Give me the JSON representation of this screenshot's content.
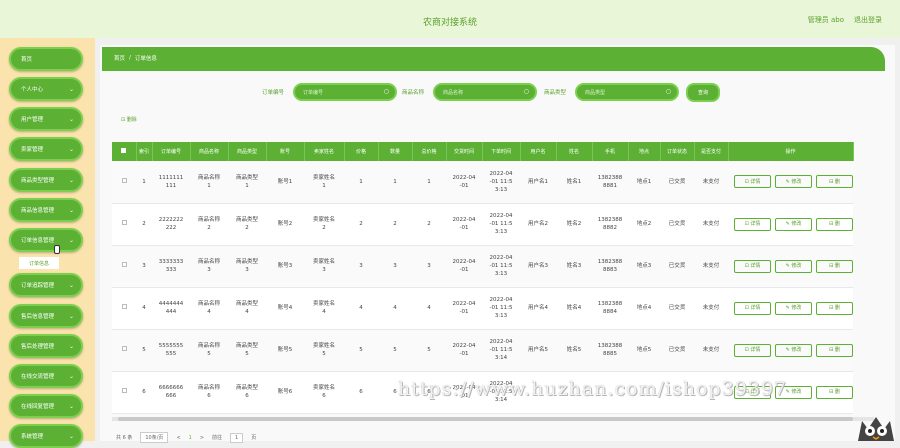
{
  "header": {
    "title": "农商对接系统",
    "user": "管理员 abo",
    "logout": "退出登录"
  },
  "sidebar": {
    "items": [
      {
        "label": "首页",
        "chev": ""
      },
      {
        "label": "个人中心",
        "chev": "⌄"
      },
      {
        "label": "用户管理",
        "chev": "⌄"
      },
      {
        "label": "卖家管理",
        "chev": "⌄"
      },
      {
        "label": "商品类型管理",
        "chev": "⌄"
      },
      {
        "label": "商品信息管理",
        "chev": "⌄"
      },
      {
        "label": "订单信息管理",
        "chev": "⌄"
      },
      {
        "label": "订单追踪管理",
        "chev": "⌄"
      },
      {
        "label": "售后信息管理",
        "chev": "⌄"
      },
      {
        "label": "售后处理管理",
        "chev": "⌄"
      },
      {
        "label": "在线交流管理",
        "chev": "⌄"
      },
      {
        "label": "在线回复管理",
        "chev": "⌄"
      },
      {
        "label": "系统管理",
        "chev": "⌄"
      }
    ],
    "sub_item": "订单信息"
  },
  "breadcrumb": {
    "home": "首页",
    "sep": "/",
    "current": "订单信息"
  },
  "search": {
    "order_no_label": "订单编号",
    "order_no_placeholder": "订单编号",
    "product_name_label": "商品名称",
    "product_name_placeholder": "商品名称",
    "product_type_label": "商品类型",
    "product_type_placeholder": "商品类型",
    "query_button": "查询"
  },
  "delete_button": "⊡ 删除",
  "table": {
    "headers": [
      "索引",
      "订单编号",
      "商品名称",
      "商品类型",
      "账号",
      "卖家姓名",
      "价格",
      "数量",
      "总价格",
      "交货时间",
      "下单时间",
      "用户名",
      "姓名",
      "手机",
      "地点",
      "订单状态",
      "是否支付",
      "操作"
    ],
    "rows": [
      {
        "idx": "1",
        "order": "1111111\n111",
        "name": "商品名称\n1",
        "type": "商品类型\n1",
        "acct": "账号1",
        "seller": "卖家姓名\n1",
        "price": "1",
        "qty": "1",
        "total": "1",
        "delivery": "2022-04\n-01",
        "time": "2022-04\n-01 11:5\n3:13",
        "user": "用户名1",
        "real": "姓名1",
        "phone": "1382388\n8881",
        "place": "地点1",
        "status": "已交货",
        "paid": "未支付"
      },
      {
        "idx": "2",
        "order": "2222222\n222",
        "name": "商品名称\n2",
        "type": "商品类型\n2",
        "acct": "账号2",
        "seller": "卖家姓名\n2",
        "price": "2",
        "qty": "2",
        "total": "2",
        "delivery": "2022-04\n-01",
        "time": "2022-04\n-01 11:5\n3:13",
        "user": "用户名2",
        "real": "姓名2",
        "phone": "1382388\n8882",
        "place": "地点2",
        "status": "已交货",
        "paid": "未支付"
      },
      {
        "idx": "3",
        "order": "3333333\n333",
        "name": "商品名称\n3",
        "type": "商品类型\n3",
        "acct": "账号3",
        "seller": "卖家姓名\n3",
        "price": "3",
        "qty": "3",
        "total": "3",
        "delivery": "2022-04\n-01",
        "time": "2022-04\n-01 11:5\n3:13",
        "user": "用户名3",
        "real": "姓名3",
        "phone": "1382388\n8883",
        "place": "地点3",
        "status": "已交货",
        "paid": "未支付"
      },
      {
        "idx": "4",
        "order": "4444444\n444",
        "name": "商品名称\n4",
        "type": "商品类型\n4",
        "acct": "账号4",
        "seller": "卖家姓名\n4",
        "price": "4",
        "qty": "4",
        "total": "4",
        "delivery": "2022-04\n-01",
        "time": "2022-04\n-01 11:5\n3:13",
        "user": "用户名4",
        "real": "姓名4",
        "phone": "1382388\n8884",
        "place": "地点4",
        "status": "已交货",
        "paid": "未支付"
      },
      {
        "idx": "5",
        "order": "5555555\n555",
        "name": "商品名称\n5",
        "type": "商品类型\n5",
        "acct": "账号5",
        "seller": "卖家姓名\n5",
        "price": "5",
        "qty": "5",
        "total": "5",
        "delivery": "2022-04\n-01",
        "time": "2022-04\n-01 11:5\n3:14",
        "user": "用户名5",
        "real": "姓名5",
        "phone": "1382388\n8885",
        "place": "地点5",
        "status": "已交货",
        "paid": "未支付"
      },
      {
        "idx": "6",
        "order": "6666666\n666",
        "name": "商品名称\n6",
        "type": "商品类型\n6",
        "acct": "账号6",
        "seller": "卖家姓名\n6",
        "price": "6",
        "qty": "6",
        "total": "6",
        "delivery": "2022-04\n-01",
        "time": "2022-04\n-01 11:5\n3:14",
        "user": "",
        "real": "",
        "phone": "",
        "place": "",
        "status": "",
        "paid": ""
      }
    ],
    "ops": [
      "⊡ 详情",
      "✎ 修改",
      "⊟ 删"
    ]
  },
  "pager": {
    "total": "共 6 条",
    "page_size": "10条/页",
    "prev": "<",
    "current": "1",
    "next": ">",
    "goto_label": "前往",
    "goto_value": "1",
    "page_suffix": "页"
  },
  "watermark": "https://www.huzhan.com/ishop39397",
  "colors": {
    "primary": "#5cb135",
    "sidebar_bg": "#fbe3ad",
    "topbar_bg": "#eaf6d8"
  }
}
